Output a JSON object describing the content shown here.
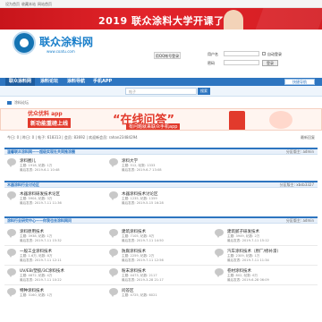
{
  "topbar": {
    "left_items": [
      "设为首页",
      "收藏本站",
      "网站首页"
    ]
  },
  "banner": {
    "headline": "2019 联众涂料大学开课了！"
  },
  "header": {
    "logo_text": "联众涂料网",
    "logo_sub": "www.coatu.com",
    "qq_login": "用QQ帐号登录",
    "login": {
      "user_label": "用户名",
      "pass_label": "密码",
      "auto_login": "自动登录",
      "button": "登录"
    }
  },
  "nav": {
    "items": [
      "联众涂料网",
      "涂料论坛",
      "涂料导航",
      "手机APP"
    ],
    "quick": "快捷导航"
  },
  "subnav": {
    "search_placeholder": "帖子",
    "search_btn": "搜索"
  },
  "breadcrumb": {
    "text": "涂料论坛"
  },
  "banner2": {
    "left_line1": "优众优料 app",
    "left_line2": "新功能重磅上线",
    "center": "“在线问答”",
    "sub": "有问题就来联众手机app"
  },
  "stats": {
    "text": "今日: 0 | 昨日: 0 | 帖子: 618313 | 会员: 83692 | 欢迎新会员: rahan23484294",
    "right": "最新回复"
  },
  "sections": [
    {
      "title": "温馨联众涂料网——超级实现社共同推涂圈",
      "mod": "分区版主: admin",
      "forums": [
        {
          "name": "涂料圈儿",
          "meta": "主题: 1918, 帖数: 1万",
          "meta2": "最后发表: 2019-6-1 10:48"
        },
        {
          "name": "涂料大学",
          "meta": "主题: 512, 帖数: 1333",
          "meta2": "最后发表: 2019-6-7 13:08"
        }
      ]
    },
    {
      "title": "木器涂料行业讨论区",
      "mod": "分区版主: xbsb3327",
      "forums": [
        {
          "name": "木器涂料研发技术论区",
          "meta": "主题: 5904, 帖数: 3万",
          "meta2": "最后发表: 2019-7-11 11:36"
        },
        {
          "name": "木器涂料技术讨论区",
          "meta": "主题: 1235, 帖数: 1359",
          "meta2": "最后发表: 2019-5-15 16:28"
        }
      ]
    },
    {
      "title": "涂料行业研究中心——你我也去涂料网问",
      "mod": "分区版主: admin",
      "forums": [
        {
          "name": "涂料原用技术",
          "meta": "主题: 3938, 帖数: 1万",
          "meta2": "最后发表: 2019-7-11 15:32"
        },
        {
          "name": "建筑涂料技术",
          "meta": "主题: 7105, 帖数: 8万",
          "meta2": "最后发表: 2019-7-11 14:50"
        },
        {
          "name": "建筑腻子研发技术",
          "meta": "主题: 3949, 帖数: 2万",
          "meta2": "最后发表: 2019-7-11 15:12"
        },
        {
          "name": "一般工业涂料技术",
          "meta": "主题: 1.6万, 帖数: 8万",
          "meta2": "最后发表: 2019-7-11 12:11"
        },
        {
          "name": "防腐涂料技术",
          "meta": "主题: 2259, 帖数: 2万",
          "meta2": "最后发表: 2019-7-11 12:56"
        },
        {
          "name": "汽车涂料技术（原厂/修补漆）",
          "meta": "主题: 2309, 帖数: 1万",
          "meta2": "最后发表: 2019-7-11 11:34"
        },
        {
          "name": "UV/EB/塑胶/3C涂料技术",
          "meta": "主题: 4672, 帖数: 4万",
          "meta2": "最后发表: 2019-7-11 10:22"
        },
        {
          "name": "粉末涂料技术",
          "meta": "主题: 4473, 帖数: 2117",
          "meta2": "最后发表: 2019-3-28 21:17"
        },
        {
          "name": "卷材涂料技术",
          "meta": "主题: 802, 帖数: 6万",
          "meta2": "最后发表: 2019-6-28 06:09"
        },
        {
          "name": "特种涂料技术",
          "meta": "主题: 3160, 帖数: 1万",
          "meta2": ""
        },
        {
          "name": "问答区",
          "meta": "主题: 4725, 帖数: 6021",
          "meta2": ""
        }
      ]
    }
  ],
  "colors": {
    "nav": "#2d75c0",
    "banner_red": "#d41d22",
    "accent_red": "#e23a2c"
  }
}
